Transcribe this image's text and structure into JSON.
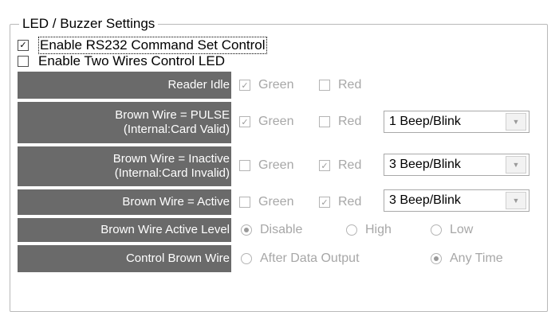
{
  "group": {
    "title": "LED / Buzzer Settings"
  },
  "enable_rs232": {
    "label": "Enable RS232 Command Set Control",
    "checked": true,
    "check_glyph": "✓"
  },
  "enable_two_wires": {
    "label": "Enable Two Wires Control LED",
    "checked": false
  },
  "rows": {
    "reader_idle": {
      "label": "Reader Idle",
      "green": {
        "label": "Green",
        "checked": true,
        "glyph": "✓"
      },
      "red": {
        "label": "Red",
        "checked": false
      }
    },
    "pulse": {
      "label_line1": "Brown Wire = PULSE",
      "label_line2": "(Internal:Card Valid)",
      "green": {
        "label": "Green",
        "checked": true,
        "glyph": "✓"
      },
      "red": {
        "label": "Red",
        "checked": false
      },
      "select_value": "1 Beep/Blink"
    },
    "inactive": {
      "label_line1": "Brown Wire = Inactive",
      "label_line2": "(Internal:Card Invalid)",
      "green": {
        "label": "Green",
        "checked": false
      },
      "red": {
        "label": "Red",
        "checked": true,
        "glyph": "✓"
      },
      "select_value": "3 Beep/Blink"
    },
    "active": {
      "label": "Brown Wire = Active",
      "green": {
        "label": "Green",
        "checked": false
      },
      "red": {
        "label": "Red",
        "checked": true,
        "glyph": "✓"
      },
      "select_value": "3 Beep/Blink"
    },
    "active_level": {
      "label": "Brown Wire Active Level",
      "options": [
        "Disable",
        "High",
        "Low"
      ],
      "selected": "Disable"
    },
    "control": {
      "label": "Control Brown Wire",
      "options": [
        "After Data Output",
        "Any Time"
      ],
      "selected": "Any Time"
    }
  },
  "dropdown_arrow": "▼"
}
